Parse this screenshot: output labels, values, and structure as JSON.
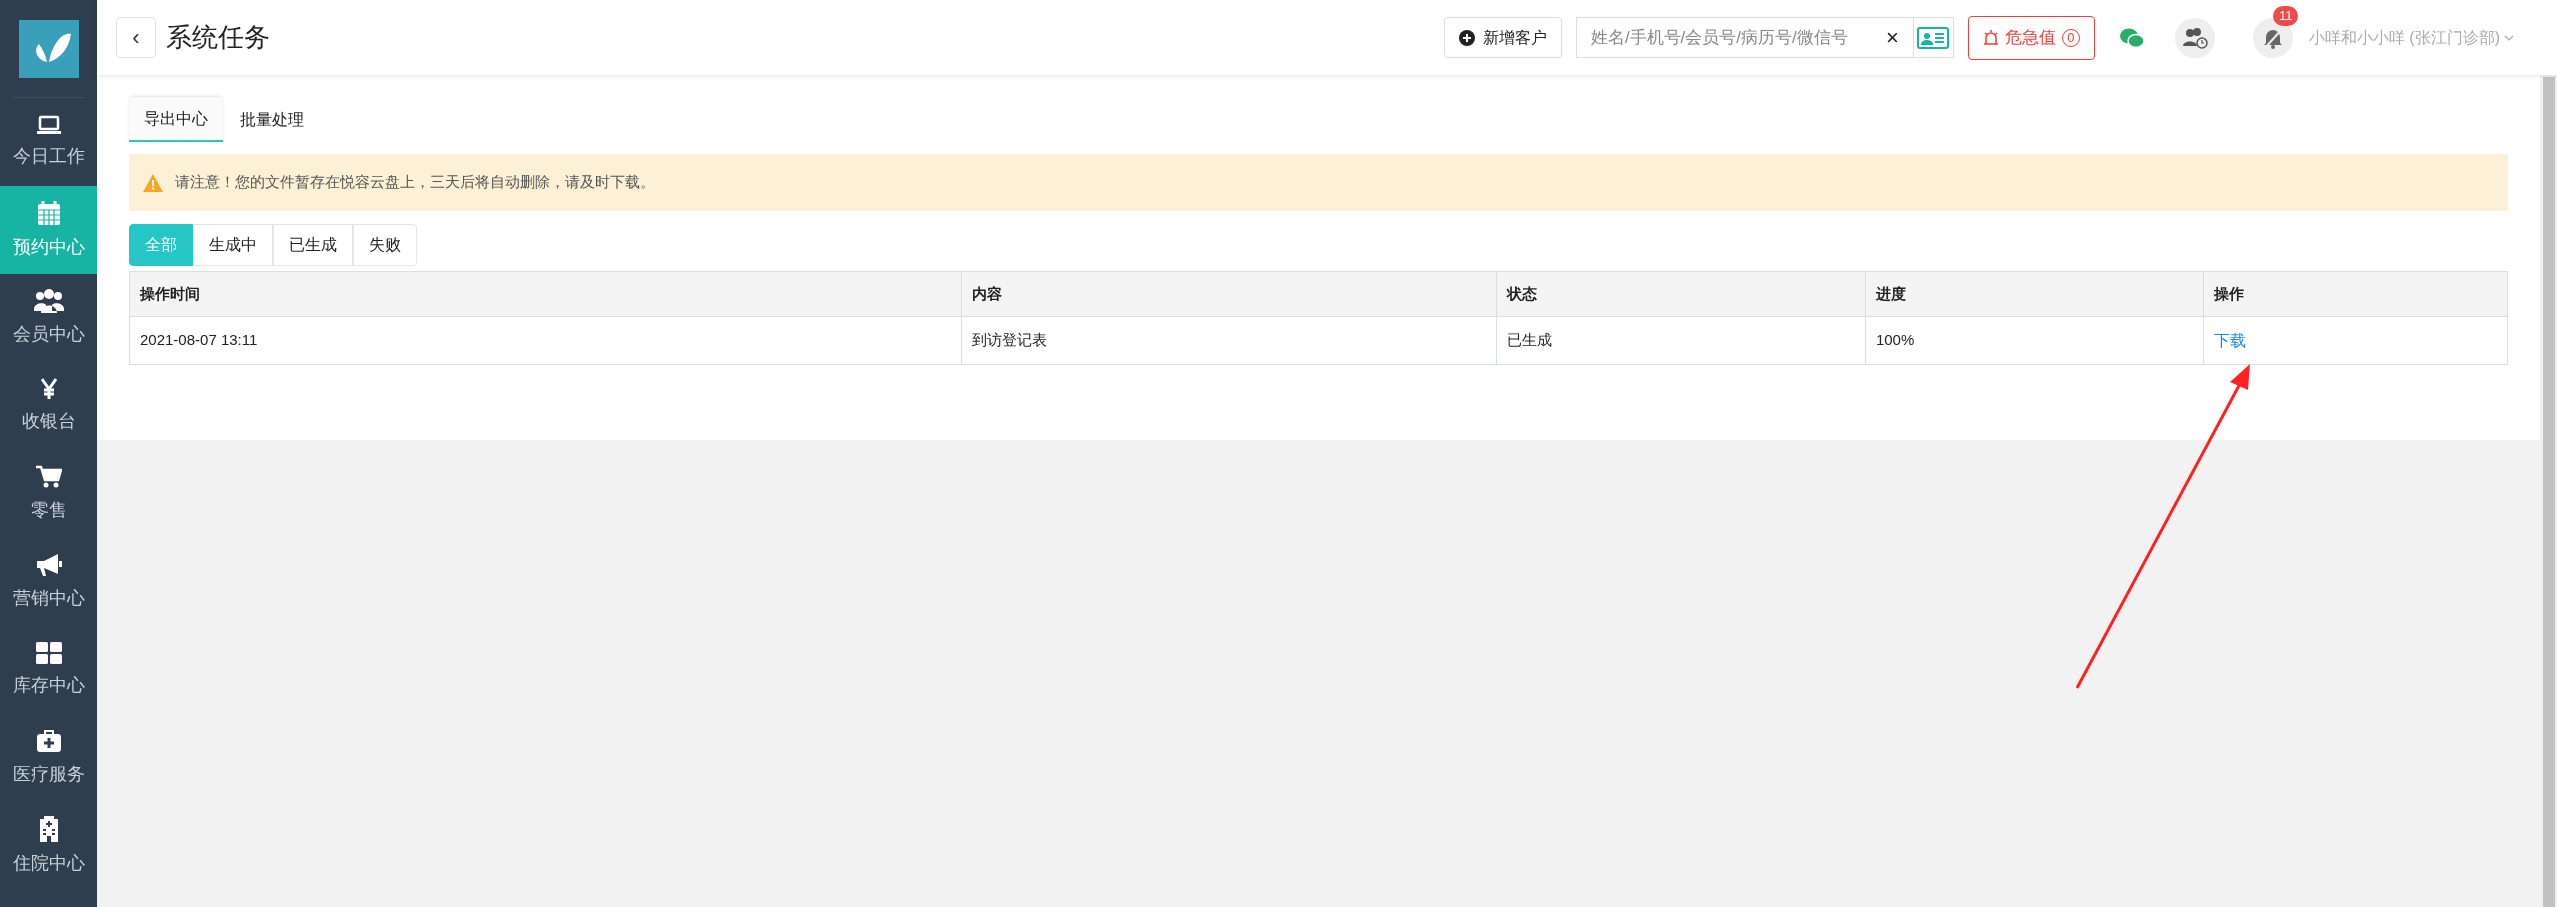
{
  "sidebar": {
    "items": [
      {
        "label": "今日工作",
        "selected": false
      },
      {
        "label": "预约中心",
        "selected": true
      },
      {
        "label": "会员中心",
        "selected": false
      },
      {
        "label": "收银台",
        "selected": false
      },
      {
        "label": "零售",
        "selected": false
      },
      {
        "label": "营销中心",
        "selected": false
      },
      {
        "label": "库存中心",
        "selected": false
      },
      {
        "label": "医疗服务",
        "selected": false
      },
      {
        "label": "住院中心",
        "selected": false
      }
    ]
  },
  "header": {
    "back_button": "‹",
    "title": "系统任务",
    "new_customer_button": "新增客户",
    "search": {
      "placeholder": "姓名/手机号/会员号/病历号/微信号"
    },
    "clear_button": "×",
    "critical_button": {
      "label": "危急值",
      "count": "0"
    },
    "notification_badge": "11",
    "user": "小咩和小小咩 (张江门诊部)"
  },
  "tabs": [
    {
      "label": "导出中心",
      "selected": true
    },
    {
      "label": "批量处理",
      "selected": false
    }
  ],
  "notice": "请注意！您的文件暂存在悦容云盘上，三天后将自动删除，请及时下载。",
  "filters": [
    {
      "label": "全部",
      "selected": true
    },
    {
      "label": "生成中",
      "selected": false
    },
    {
      "label": "已生成",
      "selected": false
    },
    {
      "label": "失败",
      "selected": false
    }
  ],
  "table": {
    "columns": [
      "操作时间",
      "内容",
      "状态",
      "进度",
      "操作"
    ],
    "rows": [
      {
        "cells": [
          "2021-08-07 13:11",
          "到访登记表",
          "已生成",
          "100%"
        ],
        "action": "下载"
      }
    ]
  }
}
